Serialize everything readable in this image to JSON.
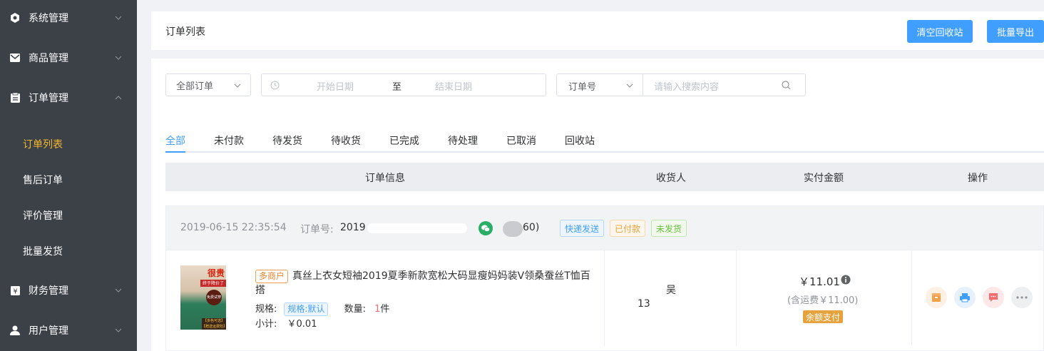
{
  "sidebar": {
    "items": [
      {
        "label": "系统管理",
        "icon": "gear-icon"
      },
      {
        "label": "商品管理",
        "icon": "envelope-icon"
      },
      {
        "label": "订单管理",
        "icon": "clipboard-icon"
      },
      {
        "label": "财务管理",
        "icon": "yen-icon"
      },
      {
        "label": "用户管理",
        "icon": "user-icon"
      }
    ],
    "sub_items": [
      {
        "label": "订单列表",
        "active": true
      },
      {
        "label": "售后订单"
      },
      {
        "label": "评价管理"
      },
      {
        "label": "批量发货"
      }
    ]
  },
  "header": {
    "title": "订单列表",
    "clear_recycle_label": "清空回收站",
    "batch_export_label": "批量导出"
  },
  "filters": {
    "order_type": "全部订单",
    "start_date_placeholder": "开始日期",
    "date_separator": "至",
    "end_date_placeholder": "结束日期",
    "search_field": "订单号",
    "search_placeholder": "请输入搜索内容"
  },
  "tabs": [
    "全部",
    "未付款",
    "待发货",
    "待收货",
    "已完成",
    "待处理",
    "已取消",
    "回收站"
  ],
  "table": {
    "headers": [
      "订单信息",
      "收货人",
      "实付金额",
      "操作"
    ]
  },
  "order": {
    "datetime": "2019-06-15 22:35:54",
    "order_no_label": "订单号:",
    "order_no": "2019",
    "buyer_suffix": "60)",
    "tags": [
      "快递发送",
      "已付款",
      "未发货"
    ],
    "product": {
      "image_text_top": "很贵",
      "image_text_strip": "终于降价了",
      "image_text_circle": "免费试穿",
      "image_text_bottom": "【多色可选】【赠送运费险】",
      "badge": "多商户",
      "title": "真丝上衣女短袖2019夏季新款宽松大码显瘦妈妈装V领桑蚕丝T恤百搭",
      "spec_label": "规格:",
      "spec_value": "规格:默认",
      "qty_label": "数量:",
      "qty_value": "1",
      "qty_unit": "件",
      "subtotal_label": "小计:",
      "subtotal_value": "￥0.01"
    },
    "receiver": {
      "name": "吴",
      "phone": "13"
    },
    "amount": {
      "total": "￥11.01",
      "shipping": "(含运费￥11.00)",
      "pay_method": "余额支付"
    },
    "actions": [
      {
        "icon": "ship-icon",
        "color": "#f5a04a"
      },
      {
        "icon": "print-icon",
        "color": "#409eff"
      },
      {
        "icon": "message-icon",
        "color": "#f56c6c"
      },
      {
        "icon": "more-icon",
        "color": "#909399"
      }
    ]
  },
  "colors": {
    "sidebar_bg": "#3c4047",
    "active_sub": "#f5b82e",
    "primary": "#409eff"
  }
}
